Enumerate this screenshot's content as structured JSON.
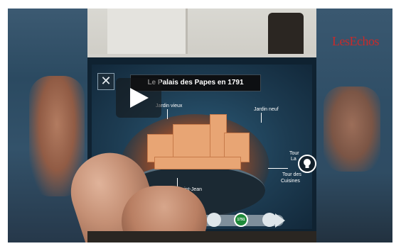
{
  "app": {
    "screen_title": "Le Palais des Papes en 1791",
    "close_label": "✕",
    "logo_text": "LesEchos"
  },
  "labels": {
    "jardin_vieux": "Jardin vieux",
    "jardin_neuf": "Jardin neuf",
    "tour_partial": "Tour",
    "tour_partial2": "La",
    "tour_saint_jean": "Tour Saint-Jean",
    "tour_des_cuisines_1": "Tour des",
    "tour_des_cuisines_2": "Cuisines"
  },
  "timeline": {
    "active_year": "1791"
  },
  "colors": {
    "logo": "#c82a2a",
    "timeline_active": "#1f8a3a",
    "model": "#e8a574"
  },
  "icons": [
    "close-icon",
    "play-icon",
    "lightbulb-icon",
    "film-icon",
    "arrow-right-icon"
  ]
}
